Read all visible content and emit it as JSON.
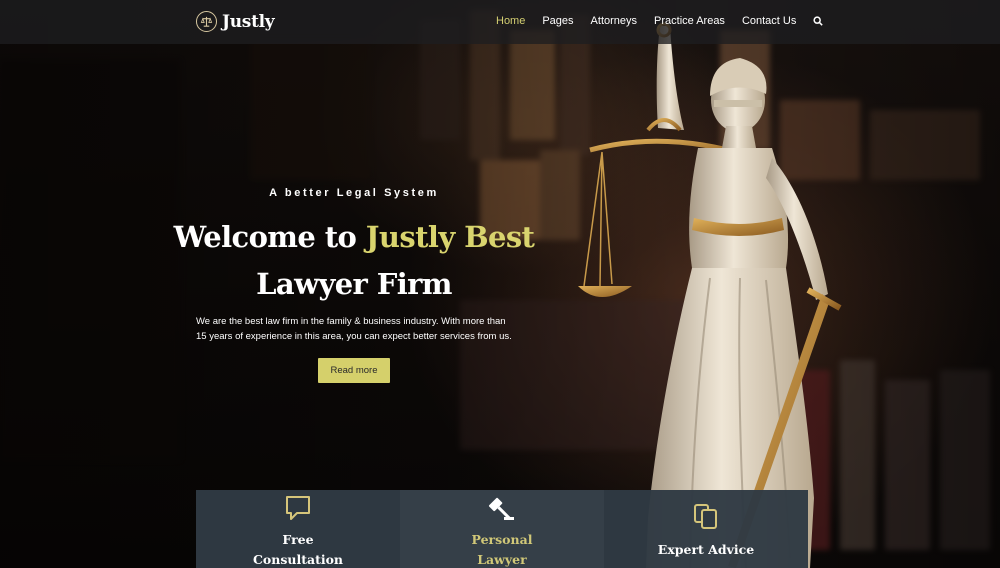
{
  "brand": {
    "name": "Justly"
  },
  "nav": {
    "items": [
      {
        "label": "Home",
        "active": true
      },
      {
        "label": "Pages",
        "active": false
      },
      {
        "label": "Attorneys",
        "active": false
      },
      {
        "label": "Practice Areas",
        "active": false
      },
      {
        "label": "Contact Us",
        "active": false
      }
    ],
    "search_icon": "search-icon"
  },
  "hero": {
    "eyebrow": "A better Legal System",
    "headline_part1": "Welcome to ",
    "headline_accent": "Justly Best",
    "headline_part2": "Lawyer Firm",
    "blurb_line1": "We are the best law firm in the family & business industry. With more than",
    "blurb_line2": "15 years of experience in this area, you can expect better services from us.",
    "cta_label": "Read more"
  },
  "features": [
    {
      "icon": "chat-bubble-icon",
      "line1": "Free",
      "line2": "Consultation",
      "highlight": false
    },
    {
      "icon": "gavel-icon",
      "line1": "Personal",
      "line2": "Lawyer",
      "highlight": true
    },
    {
      "icon": "documents-icon",
      "line1": "Expert Advice",
      "line2": "",
      "highlight": false
    }
  ],
  "colors": {
    "accent": "#d5d06b",
    "header_bg": "#1e1e20",
    "feature_bg": "#303a43",
    "text": "#ffffff"
  }
}
